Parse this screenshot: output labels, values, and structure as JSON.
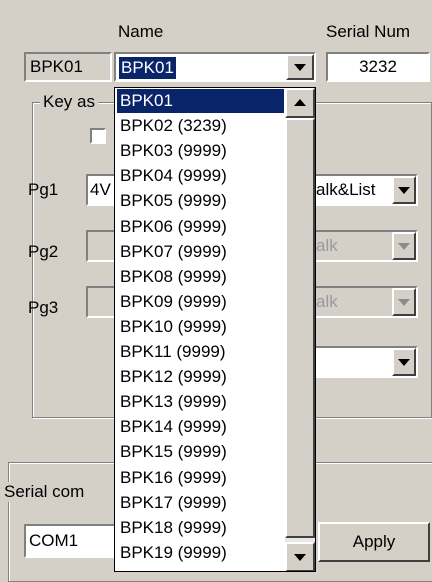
{
  "headers": {
    "name": "Name",
    "serial_number": "Serial Num"
  },
  "device": {
    "id": "BPK01",
    "name_value": "BPK01",
    "serial_value": "3232"
  },
  "key_group": {
    "title": "Key as",
    "checkbox_checked": false
  },
  "pages": [
    {
      "label": "Pg1",
      "value": "4V",
      "mode": "alk&List",
      "enabled": true
    },
    {
      "label": "Pg2",
      "value": "",
      "mode": "alk",
      "enabled": false
    },
    {
      "label": "Pg3",
      "value": "",
      "mode": "alk",
      "enabled": false
    }
  ],
  "extra_select": {
    "value": ""
  },
  "serial_group": {
    "title": "Serial com",
    "port_value": "COM1",
    "apply_label": "Apply"
  },
  "dropdown": {
    "selected_index": 0,
    "items": [
      "BPK01",
      "BPK02 (3239)",
      "BPK03 (9999)",
      "BPK04 (9999)",
      "BPK05 (9999)",
      "BPK06 (9999)",
      "BPK07 (9999)",
      "BPK08 (9999)",
      "BPK09 (9999)",
      "BPK10 (9999)",
      "BPK11 (9999)",
      "BPK12 (9999)",
      "BPK13 (9999)",
      "BPK14 (9999)",
      "BPK15 (9999)",
      "BPK16 (9999)",
      "BPK17 (9999)",
      "BPK18 (9999)",
      "BPK19 (9999)"
    ]
  }
}
